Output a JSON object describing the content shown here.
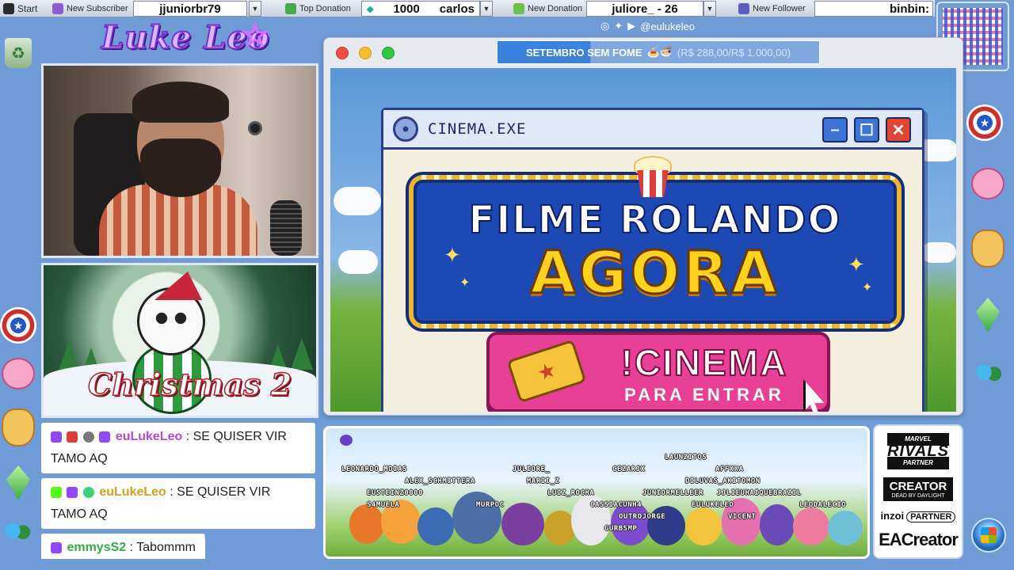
{
  "taskbar": {
    "start_label": "Start",
    "new_subscriber_label": "New Subscriber",
    "new_subscriber_value": "jjuniorbr79",
    "top_donation_label": "Top Donation",
    "top_donation_amount": "1000",
    "top_donation_user": "carlos",
    "new_donation_label": "New Donation",
    "new_donation_value": "juliore_ - 26",
    "new_follower_label": "New Follower",
    "new_follower_value": "binbin:"
  },
  "branding": {
    "logo_text": "Luke Leo",
    "social_handle": "@eulukeleo"
  },
  "main_window": {
    "goal_text": "SETEMBRO SEM FOME",
    "goal_emoji": "🍝🍜",
    "goal_amount": "(R$ 288,00/R$ 1.000,00)",
    "goal_progress": 0.288
  },
  "cinema": {
    "window_title": "CINEMA.EXE",
    "headline_1": "FILME ROLANDO",
    "headline_2": "AGORA",
    "button_command": "!CINEMA",
    "button_subtitle": "PARA ENTRAR"
  },
  "xmas": {
    "title": "Christmas 2"
  },
  "chat": {
    "messages": [
      {
        "user": "euLukeLeo",
        "sep": " : ",
        "text": "SE QUISER VIR TAMO AQ"
      },
      {
        "user": "euLukeLeo",
        "sep": " : ",
        "text": "SE QUISER VIR TAMO AQ"
      },
      {
        "user": "emmysS2",
        "sep": " : ",
        "text": "Tabommm"
      }
    ]
  },
  "strip": {
    "usernames": [
      "LEONARDO_MDIAS",
      "ALEX_SCHMITTERA",
      "EUSTEINZ0000",
      "S4MUELA",
      "JULIORE_",
      "MARII_Z",
      "MURPOC",
      "LUIZ_ROCHA",
      "CASSIACUNH4",
      "CEZARJX",
      "LAUNZITOS",
      "AFFXXA",
      "DILUVAS_AKITOMON",
      "JUNIORMELLEER",
      "JJLIEUHAIQUEBRAZIL",
      "OUTROJORGE",
      "EULUKELEO",
      "VICENT",
      "LEODALECIO",
      "GURBSMP"
    ]
  },
  "sponsors": {
    "rivals_top": "MARVEL",
    "rivals_name": "RIVALS",
    "rivals_sub": "PARTNER",
    "creator_title": "CREATOR",
    "creator_sub": "DEAD BY DAYLIGHT",
    "inzoi_name": "inzoi",
    "inzoi_sub": "PARTNER",
    "ea_creator": "EACreator"
  },
  "colors": {
    "desktop_bg": "#6f9bd6",
    "cinema_pink": "#e83f97",
    "marquee_blue": "#1d49b5",
    "marquee_gold": "#ffd21c",
    "chat_user_purple": "#b24bd6",
    "chat_user_gold": "#d8a020",
    "chat_user_green": "#2eb04a"
  }
}
